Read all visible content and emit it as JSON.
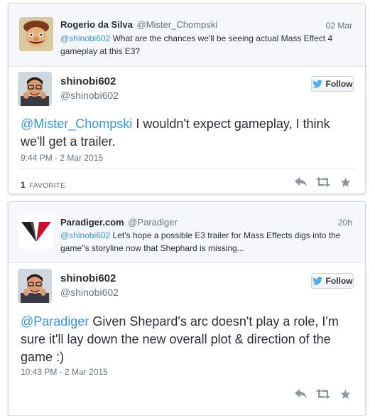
{
  "tweets": [
    {
      "parent": {
        "name": "Rogerio da Silva",
        "handle": "@Mister_Chompski",
        "time": "02 Mar",
        "mention": "@shinobi602",
        "text": " What are the chances we'll be seeing actual Mass Effect 4 gameplay at this E3?"
      },
      "reply": {
        "name": "shinobi602",
        "handle": "@shinobi602",
        "follow_label": "Follow",
        "mention": "@Mister_Chompski",
        "text": " I wouldn't expect gameplay, I think we'll get a trailer.",
        "timestamp": "9:44 PM - 2 Mar 2015",
        "favorites_count": "1",
        "favorites_label": "FAVORITE"
      }
    },
    {
      "parent": {
        "name": "Paradiger.com",
        "handle": "@Paradiger",
        "time": "20h",
        "mention": "@shinobi602",
        "text": " Let's hope a possible E3 trailer for Mass Effects digs into the game''s storyline now that Shephard is missing..."
      },
      "reply": {
        "name": "shinobi602",
        "handle": "@shinobi602",
        "follow_label": "Follow",
        "mention": "@Paradiger",
        "text": " Given Shepard's arc doesn't play a role, I'm sure it'll lay down the new overall plot & direction of the game :)",
        "timestamp": "10:43 PM - 2 Mar 2015"
      }
    }
  ],
  "icons": {
    "reply": "reply-icon",
    "retweet": "retweet-icon",
    "favorite": "star-icon",
    "follow": "twitter-bird-icon"
  },
  "colors": {
    "link": "#3b94d9",
    "follow_bird": "#55acee",
    "action_icon": "#8899a6"
  }
}
